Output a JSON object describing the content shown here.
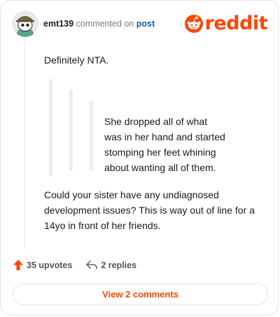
{
  "comment": {
    "username": "emt139",
    "action_text": "commented on",
    "target_link": "post",
    "paragraph_1": "Definitely NTA.",
    "quote_lines": [
      "She dropped all of what",
      "was in her hand and started",
      "stomping her feet whining",
      "about wanting all of them."
    ],
    "paragraph_2_lines": [
      "Could your sister have any undiagnosed",
      "development issues? This is way out of line for a",
      "14yo in front of her friends."
    ]
  },
  "logo": {
    "word": "reddit",
    "icon": "reddit-snoo-icon",
    "color": "#ff4500"
  },
  "actions": {
    "upvotes_label": "35 upvotes",
    "replies_label": "2 replies",
    "upvote_icon": "upvote-arrow-icon",
    "reply_icon": "reply-arrow-icon",
    "upvote_color": "#ff4500"
  },
  "view_comments": {
    "label": "View 2 comments"
  }
}
